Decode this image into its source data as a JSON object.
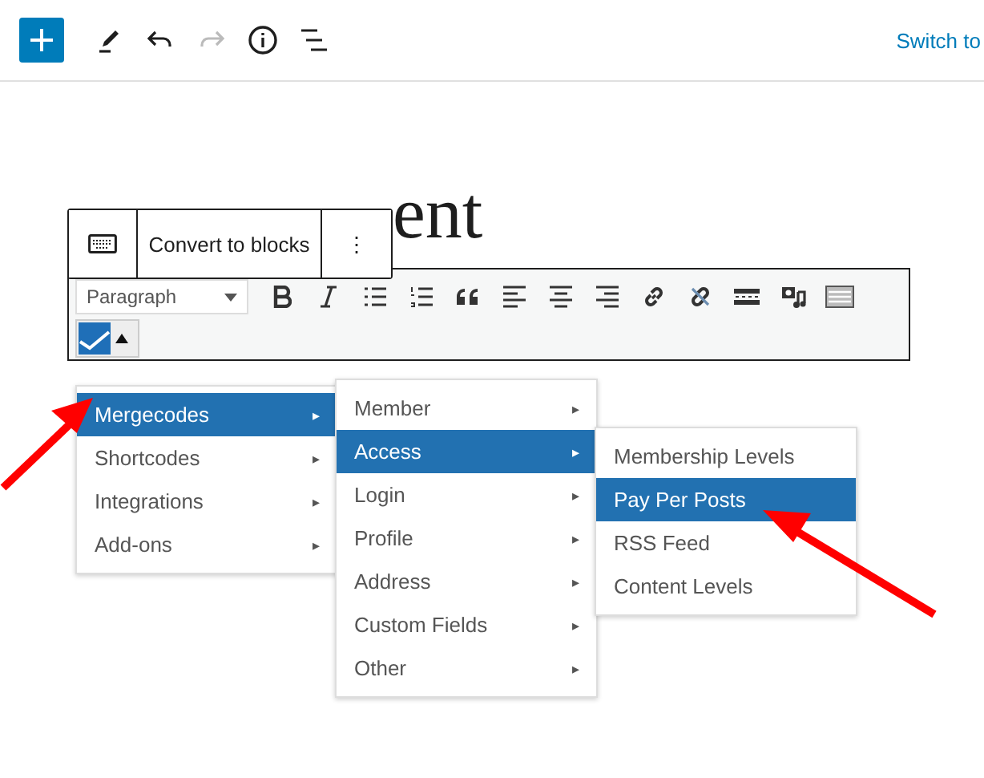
{
  "top_bar": {
    "switch_link": "Switch to"
  },
  "title": "ent",
  "block_toolbar": {
    "convert": "Convert to blocks",
    "more": "⋮"
  },
  "classic_toolbar": {
    "format": "Paragraph",
    "buttons": [
      {
        "kind": "bold"
      },
      {
        "kind": "italic"
      },
      {
        "kind": "bullet-list"
      },
      {
        "kind": "number-list"
      },
      {
        "kind": "quote"
      },
      {
        "kind": "align-left"
      },
      {
        "kind": "align-center"
      },
      {
        "kind": "align-right"
      },
      {
        "kind": "link"
      },
      {
        "kind": "unlink"
      },
      {
        "kind": "more"
      },
      {
        "kind": "media"
      },
      {
        "kind": "kitchen-sink"
      }
    ]
  },
  "menus": [
    {
      "items": [
        {
          "label": "Mergecodes",
          "selected": true,
          "arrow": "▸"
        },
        {
          "label": "Shortcodes",
          "selected": false,
          "arrow": "▸"
        },
        {
          "label": "Integrations",
          "selected": false,
          "arrow": "▸"
        },
        {
          "label": "Add-ons",
          "selected": false,
          "arrow": "▸"
        }
      ]
    },
    {
      "items": [
        {
          "label": "Member",
          "selected": false,
          "arrow": "▸"
        },
        {
          "label": "Access",
          "selected": true,
          "arrow": "▸"
        },
        {
          "label": "Login",
          "selected": false,
          "arrow": "▸"
        },
        {
          "label": "Profile",
          "selected": false,
          "arrow": "▸"
        },
        {
          "label": "Address",
          "selected": false,
          "arrow": "▸"
        },
        {
          "label": "Custom Fields",
          "selected": false,
          "arrow": "▸"
        },
        {
          "label": "Other",
          "selected": false,
          "arrow": "▸"
        }
      ]
    },
    {
      "items": [
        {
          "label": "Membership Levels",
          "selected": false
        },
        {
          "label": "Pay Per Posts",
          "selected": true
        },
        {
          "label": "RSS Feed",
          "selected": false
        },
        {
          "label": "Content Levels",
          "selected": false
        }
      ]
    }
  ]
}
